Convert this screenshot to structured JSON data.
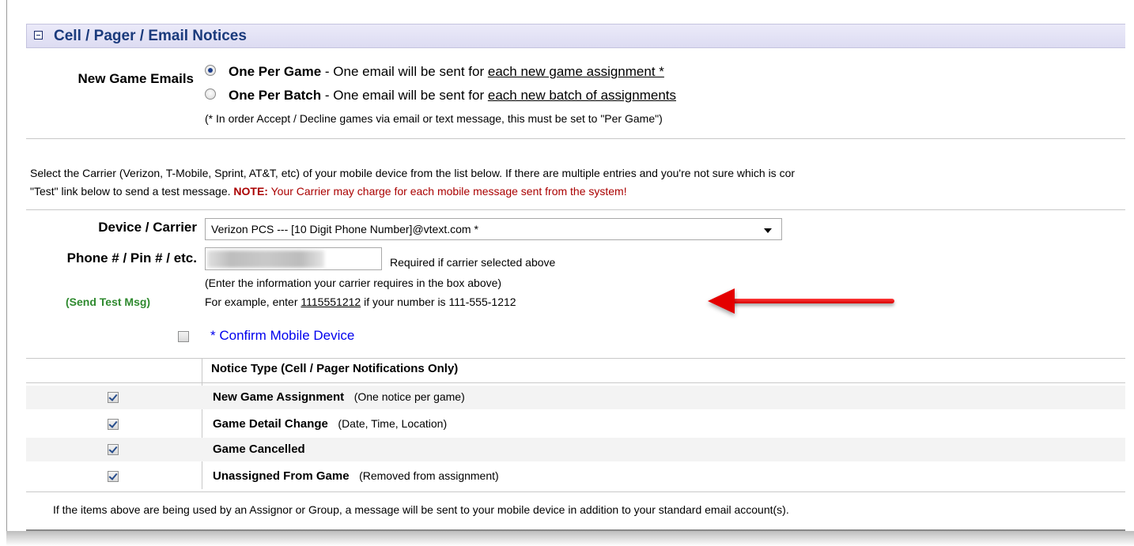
{
  "panel": {
    "title": "Cell / Pager / Email Notices"
  },
  "new_game_emails": {
    "label": "New Game Emails",
    "options": [
      {
        "name": "One Per Game",
        "desc": " - One email will be sent for ",
        "link": "each new game assignment *",
        "selected": true
      },
      {
        "name": "One Per Batch",
        "desc": " - One email will be sent for ",
        "link": "each new batch of assignments",
        "selected": false
      }
    ],
    "footnote": "(* In order Accept / Decline games via email or text message, this must be set to \"Per Game\")"
  },
  "carrier_info": {
    "line1": "Select the Carrier (Verizon, T-Mobile, Sprint, AT&T, etc) of your mobile device from the list below. If there are multiple entries and you're not sure which is cor",
    "line2_prefix": "\"Test\" link below to send a test message. ",
    "note_label": "NOTE:",
    "note_text": " Your Carrier may charge for each mobile message sent from the system!"
  },
  "device": {
    "label": "Device / Carrier",
    "selected": "Verizon PCS --- [10 Digit Phone Number]@vtext.com *"
  },
  "phone": {
    "label": "Phone # / Pin # / etc.",
    "required_text": "Required if carrier selected above",
    "help1": "(Enter the information your carrier requires in the box above)",
    "help2_prefix": "For example, enter ",
    "help2_link": "1115551212",
    "help2_suffix": " if your number is 111-555-1212",
    "send_test": "(Send Test Msg)"
  },
  "confirm": {
    "label": "* Confirm Mobile Device",
    "checked": false
  },
  "notice_table": {
    "header": "Notice Type (Cell / Pager Notifications Only)",
    "rows": [
      {
        "name": "New Game Assignment",
        "desc": "(One notice per game)",
        "checked": true
      },
      {
        "name": "Game Detail Change",
        "desc": "(Date, Time, Location)",
        "checked": true
      },
      {
        "name": "Game Cancelled",
        "desc": "",
        "checked": true
      },
      {
        "name": "Unassigned From Game",
        "desc": "(Removed from assignment)",
        "checked": true
      }
    ]
  },
  "footer_text": "If the items above are being used by an Assignor or Group, a message will be sent to your mobile device in addition to your standard email account(s).",
  "colors": {
    "header_bg": "#e3e2f6",
    "header_text": "#1a3a7c",
    "send_test": "#2f8a2f",
    "confirm": "#0000ee",
    "note": "#aa0000",
    "arrow": "#e40000"
  }
}
